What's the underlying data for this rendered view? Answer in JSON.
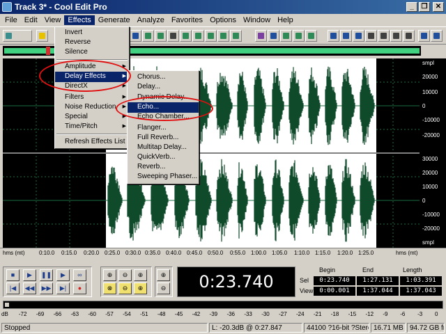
{
  "window": {
    "title": "Track 3* - Cool Edit Pro",
    "minimize": "_",
    "restore": "❐",
    "close": "✕"
  },
  "menubar": [
    {
      "label": "File"
    },
    {
      "label": "Edit"
    },
    {
      "label": "View"
    },
    {
      "label": "Effects",
      "active": true
    },
    {
      "label": "Generate"
    },
    {
      "label": "Analyze"
    },
    {
      "label": "Favorites"
    },
    {
      "label": "Options"
    },
    {
      "label": "Window"
    },
    {
      "label": "Help"
    }
  ],
  "effects_menu": {
    "items": [
      {
        "label": "Invert"
      },
      {
        "label": "Reverse"
      },
      {
        "label": "Silence"
      },
      {
        "label": "Amplitude",
        "submenu": true
      },
      {
        "label": "Delay Effects",
        "submenu": true,
        "highlighted": true
      },
      {
        "label": "DirectX",
        "submenu": true
      },
      {
        "label": "Filters",
        "submenu": true
      },
      {
        "label": "Noise Reduction",
        "submenu": true
      },
      {
        "label": "Special",
        "submenu": true
      },
      {
        "label": "Time/Pitch",
        "submenu": true
      },
      {
        "label": "Refresh Effects List"
      }
    ]
  },
  "delay_menu": {
    "items": [
      {
        "label": "Chorus..."
      },
      {
        "label": "Delay..."
      },
      {
        "label": "Dynamic Delay..."
      },
      {
        "label": "Echo...",
        "highlighted": true
      },
      {
        "label": "Echo Chamber..."
      },
      {
        "label": "Flanger..."
      },
      {
        "label": "Full Reverb..."
      },
      {
        "label": "Multitap Delay..."
      },
      {
        "label": "QuickVerb..."
      },
      {
        "label": "Reverb..."
      },
      {
        "label": "Sweeping Phaser..."
      }
    ]
  },
  "amplitude_ruler": {
    "unit": "smpl",
    "ticks_top": [
      "20000",
      "10000",
      "0",
      "-10000",
      "-20000"
    ],
    "ticks_bottom": [
      "30000",
      "20000",
      "10000",
      "0",
      "-10000",
      "-20000"
    ],
    "unit_bottom": "smpl"
  },
  "time_ruler": {
    "labels": [
      "hms (mt)",
      "0:10.0",
      "0:15.0",
      "0:20.0",
      "0:25.0",
      "0:30.0",
      "0:35.0",
      "0:40.0",
      "0:45.0",
      "0:50.0",
      "0:55.0",
      "1:00.0",
      "1:05.0",
      "1:10.0",
      "1:15.0",
      "1:20.0",
      "1:25.0",
      "hms (mt)"
    ]
  },
  "transport": {
    "buttons": [
      {
        "name": "stop",
        "glyph": "■"
      },
      {
        "name": "play",
        "glyph": "▶"
      },
      {
        "name": "pause",
        "glyph": "❚❚"
      },
      {
        "name": "play-from-cursor",
        "glyph": "▶"
      },
      {
        "name": "loop",
        "glyph": "∞"
      },
      {
        "name": "go-to-start",
        "glyph": "|◀"
      },
      {
        "name": "rewind",
        "glyph": "◀◀"
      },
      {
        "name": "fast-forward",
        "glyph": "▶▶"
      },
      {
        "name": "go-to-end",
        "glyph": "▶|"
      },
      {
        "name": "record",
        "glyph": "●"
      }
    ],
    "zoom": [
      {
        "name": "zoom-in-horizontal",
        "glyph": "⊕"
      },
      {
        "name": "zoom-out-horizontal",
        "glyph": "⊖"
      },
      {
        "name": "zoom-in-left",
        "glyph": "⊕"
      },
      {
        "name": "zoom-full",
        "glyph": "⊗"
      },
      {
        "name": "zoom-out-full",
        "glyph": "⊖"
      },
      {
        "name": "zoom-to-selection",
        "glyph": "⊕"
      },
      {
        "name": "zoom-in-vertical",
        "glyph": "⊕"
      },
      {
        "name": "zoom-out-vertical",
        "glyph": "⊖"
      }
    ]
  },
  "time_display": "0:23.740",
  "selection": {
    "col_begin": "Begin",
    "col_end": "End",
    "col_length": "Length",
    "row_sel": "Sel",
    "row_view": "View",
    "sel_begin": "0:23.740",
    "sel_end": "1:27.131",
    "sel_length": "1:03.391",
    "view_begin": "0:00.001",
    "view_end": "1:37.044",
    "view_length": "1:37.043"
  },
  "level_scale": [
    "dB",
    "-72",
    "-69",
    "-66",
    "-63",
    "-60",
    "-57",
    "-54",
    "-51",
    "-48",
    "-45",
    "-42",
    "-39",
    "-36",
    "-33",
    "-30",
    "-27",
    "-24",
    "-21",
    "-18",
    "-15",
    "-12",
    "-9",
    "-6",
    "-3",
    "0"
  ],
  "status": {
    "state": "Stopped",
    "level": "L: -20.3dB @   0:27.847",
    "format": "44100 ?16-bit ?Stereo",
    "size": "16.71 MB",
    "free": "94.72 GB free"
  },
  "colors": {
    "waveform": "#0f4a2a",
    "selection_bg": "#ffffff",
    "unselected_bg": "#000000",
    "grid": "#1c6e3e",
    "annotation": "#e01010",
    "menu_highlight": "#0a246a"
  }
}
